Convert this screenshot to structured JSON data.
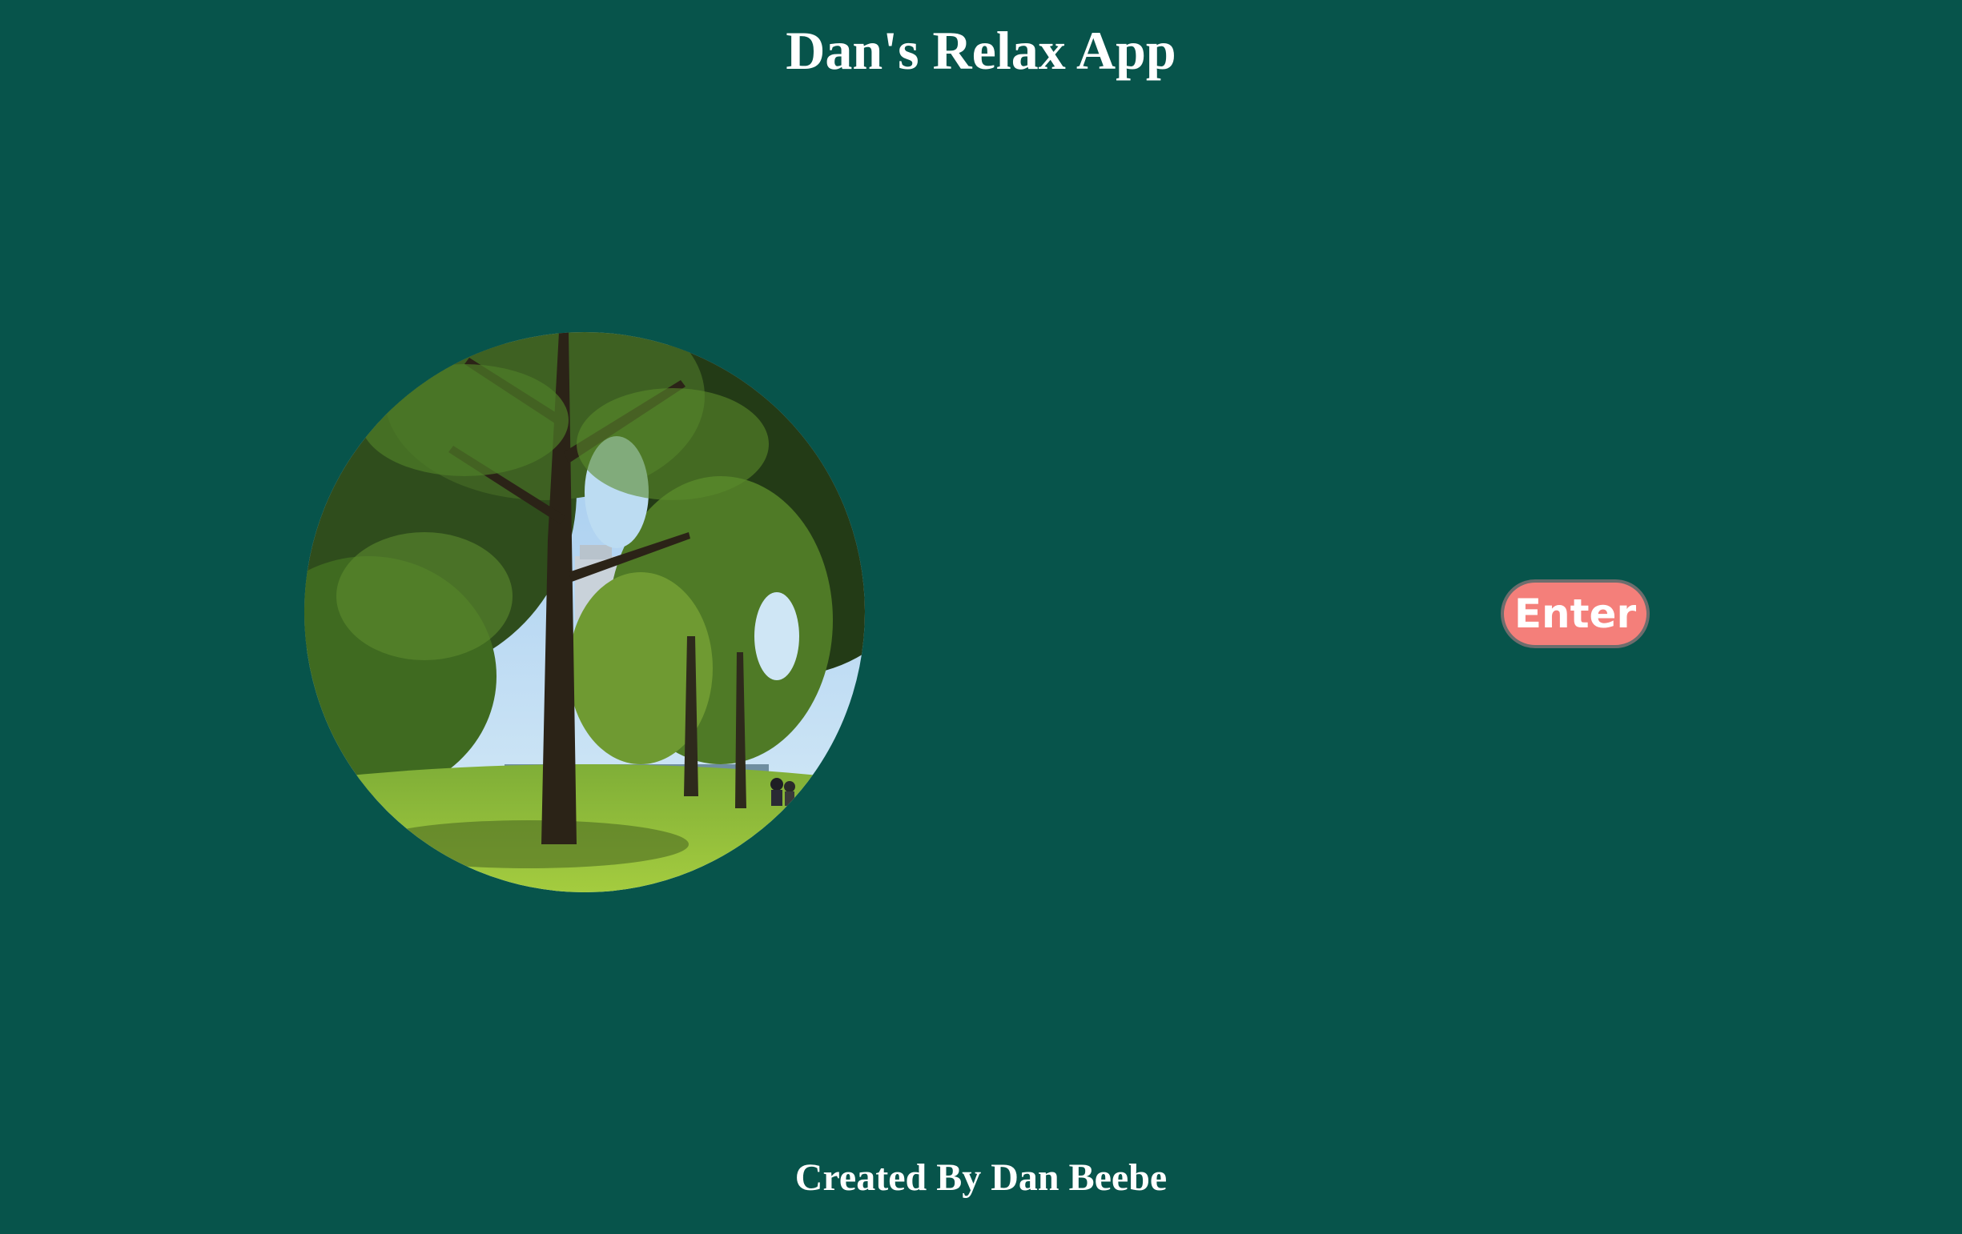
{
  "header": {
    "title": "Dan's Relax App"
  },
  "main": {
    "photo_icon": "park-photo",
    "enter_label": "Enter"
  },
  "footer": {
    "credit": "Created By Dan Beebe"
  },
  "colors": {
    "background": "#07544b",
    "button_fill": "#f47f7a",
    "button_border": "#6d6d6d",
    "text": "#ffffff"
  }
}
